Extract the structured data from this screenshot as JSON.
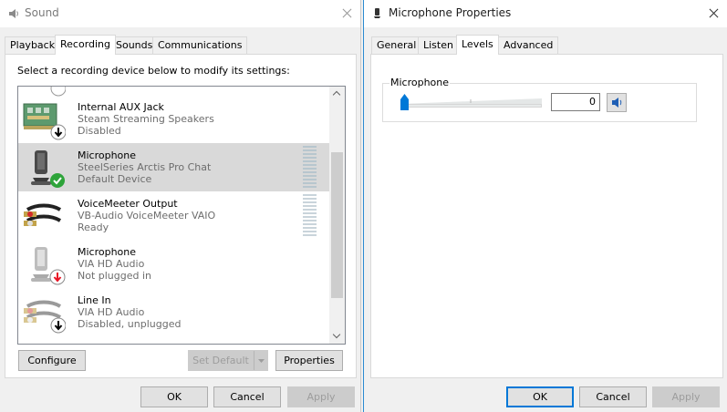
{
  "sound_window": {
    "title": "Sound",
    "tabs": [
      "Playback",
      "Recording",
      "Sounds",
      "Communications"
    ],
    "active_tab": "Recording",
    "instruction": "Select a recording device below to modify its settings:",
    "devices": [
      {
        "name": "Internal AUX Jack",
        "desc": "Steam Streaming Speakers",
        "status": "Disabled",
        "icon": "sound-card-icon",
        "badge": "arrow-down-badge"
      },
      {
        "name": "Microphone",
        "desc": "SteelSeries Arctis Pro Chat",
        "status": "Default Device",
        "icon": "microphone-icon",
        "badge": "green-check-badge",
        "selected": true
      },
      {
        "name": "VoiceMeeter Output",
        "desc": "VB-Audio VoiceMeeter VAIO",
        "status": "Ready",
        "icon": "rca-cable-icon"
      },
      {
        "name": "Microphone",
        "desc": "VIA HD Audio",
        "status": "Not plugged in",
        "icon": "microphone-icon",
        "badge": "red-arrow-down-badge"
      },
      {
        "name": "Line In",
        "desc": "VIA HD Audio",
        "status": "Disabled, unplugged",
        "icon": "rca-cable-icon",
        "badge": "arrow-down-badge"
      }
    ],
    "buttons": {
      "configure": "Configure",
      "set_default": "Set Default",
      "properties": "Properties",
      "ok": "OK",
      "cancel": "Cancel",
      "apply": "Apply"
    }
  },
  "mic_window": {
    "title": "Microphone Properties",
    "tabs": [
      "General",
      "Listen",
      "Levels",
      "Advanced"
    ],
    "active_tab": "Levels",
    "levels": {
      "label": "Microphone",
      "value": "0",
      "slider_level": 0
    },
    "buttons": {
      "ok": "OK",
      "cancel": "Cancel",
      "apply": "Apply"
    }
  },
  "colors": {
    "accent": "#0078d7",
    "selected_row": "#d9d9d9",
    "check_green": "#2ea43a",
    "badge_red": "#e81123"
  }
}
